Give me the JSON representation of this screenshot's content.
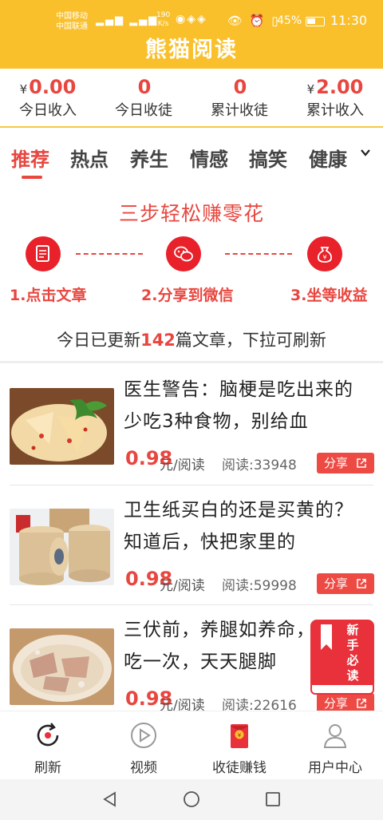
{
  "status_bar": {
    "carrier1": "中国移动",
    "carrier2": "中国联通",
    "speed_value": "190",
    "speed_unit": "K/s",
    "battery": "45%",
    "time": "11:30"
  },
  "app": {
    "title": "熊猫阅读"
  },
  "stats": [
    {
      "currency": "¥",
      "value": "0.00",
      "label": "今日收入"
    },
    {
      "currency": "",
      "value": "0",
      "label": "今日收徒"
    },
    {
      "currency": "",
      "value": "0",
      "label": "累计收徒"
    },
    {
      "currency": "¥",
      "value": "2.00",
      "label": "累计收入"
    }
  ],
  "tabs": [
    "推荐",
    "热点",
    "养生",
    "情感",
    "搞笑",
    "健康"
  ],
  "steps": {
    "title": "三步轻松赚零花",
    "items": [
      "1.点击文章",
      "2.分享到微信",
      "3.坐等收益"
    ]
  },
  "update": {
    "prefix": "今日已更新",
    "count": "142",
    "suffix": "篇文章，下拉可刷新"
  },
  "articles": [
    {
      "title": "医生警告：脑梗是吃出来的 少吃3种食物，别给血",
      "price": "0.98",
      "unit": "元/阅读",
      "reads": "阅读:33948",
      "share": "分享"
    },
    {
      "title": "卫生纸买白的还是买黄的？知道后，快把家里的",
      "price": "0.98",
      "unit": "元/阅读",
      "reads": "阅读:59998",
      "share": "分享"
    },
    {
      "title": "三伏前，养腿如养命，一周吃一次，天天腿脚",
      "price": "0.98",
      "unit": "元/阅读",
      "reads": "阅读:22616",
      "share": "分享"
    }
  ],
  "newbie_badge": "新手必读",
  "bottom_nav": [
    "刷新",
    "视频",
    "收徒赚钱",
    "用户中心"
  ],
  "colors": {
    "brand_yellow": "#f9c02c",
    "accent_red": "#e8463f"
  }
}
